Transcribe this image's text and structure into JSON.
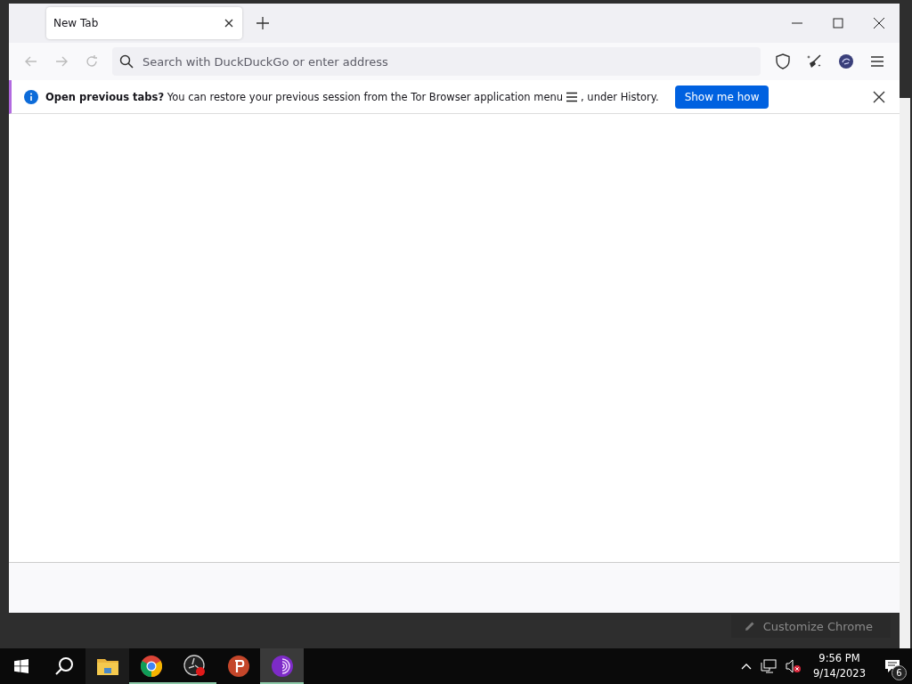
{
  "browser": {
    "tabs": [
      {
        "title": "New Tab",
        "selected": true
      }
    ],
    "address_bar": {
      "placeholder": "Search with DuckDuckGo or enter address"
    },
    "notification": {
      "message": "**Open previous tabs?** You can restore your previous session from the Tor Browser application menu",
      "message_end": ", under History.",
      "button": "Show me how"
    }
  },
  "background_window": {
    "button": "Customize Chrome"
  },
  "taskbar": {
    "apps": [
      {
        "kind": "explorer",
        "running": false,
        "active": false
      },
      {
        "kind": "chrome",
        "running": true,
        "active": false
      },
      {
        "kind": "obs",
        "running": true,
        "active": false
      },
      {
        "kind": "psiphon",
        "running": false,
        "active": false
      },
      {
        "kind": "tor",
        "running": true,
        "active": true
      }
    ],
    "time": "9:56 PM",
    "date": "9/14/2023",
    "notification_count": "6"
  }
}
